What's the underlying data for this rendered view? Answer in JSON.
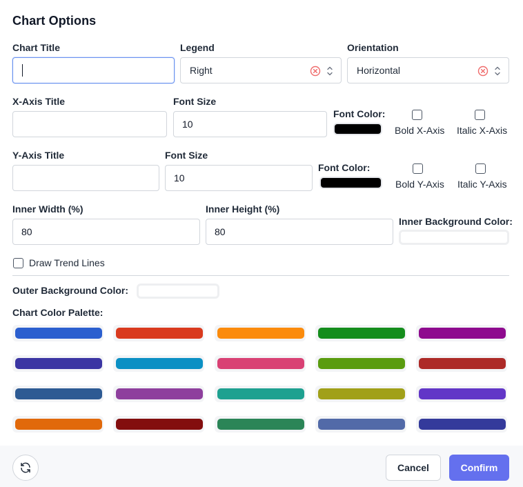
{
  "dialog": {
    "title": "Chart Options"
  },
  "chart_title": {
    "label": "Chart Title",
    "value": ""
  },
  "legend": {
    "label": "Legend",
    "value": "Right"
  },
  "orientation": {
    "label": "Orientation",
    "value": "Horizontal"
  },
  "x_axis": {
    "title_label": "X-Axis Title",
    "title_value": "",
    "font_size_label": "Font Size",
    "font_size_value": "10",
    "font_color_label": "Font Color:",
    "font_color": "#000000",
    "bold_label": "Bold X-Axis",
    "italic_label": "Italic X-Axis"
  },
  "y_axis": {
    "title_label": "Y-Axis Title",
    "title_value": "",
    "font_size_label": "Font Size",
    "font_size_value": "10",
    "font_color_label": "Font Color:",
    "font_color": "#000000",
    "bold_label": "Bold Y-Axis",
    "italic_label": "Italic Y-Axis"
  },
  "inner": {
    "width_label": "Inner Width (%)",
    "width_value": "80",
    "height_label": "Inner Height (%)",
    "height_value": "80",
    "bg_label": "Inner Background Color:",
    "bg_color": "#ffffff"
  },
  "trend": {
    "label": "Draw Trend Lines",
    "checked": false
  },
  "outer": {
    "bg_label": "Outer Background Color:",
    "bg_color": "#ffffff"
  },
  "palette": {
    "label": "Chart Color Palette:",
    "colors": [
      "#2b5fcf",
      "#d93a1e",
      "#fb8b0c",
      "#148d1c",
      "#8e0a8e",
      "#3b35a3",
      "#0b90c4",
      "#d94174",
      "#5a9c0f",
      "#ad2a27",
      "#2d5a93",
      "#8e3f9d",
      "#1ea190",
      "#a1a019",
      "#6236c7",
      "#e1690b",
      "#830e0e",
      "#2b8557",
      "#526aa8",
      "#343a9b"
    ]
  },
  "footer": {
    "refresh_icon": "refresh-icon",
    "cancel_label": "Cancel",
    "confirm_label": "Confirm"
  }
}
